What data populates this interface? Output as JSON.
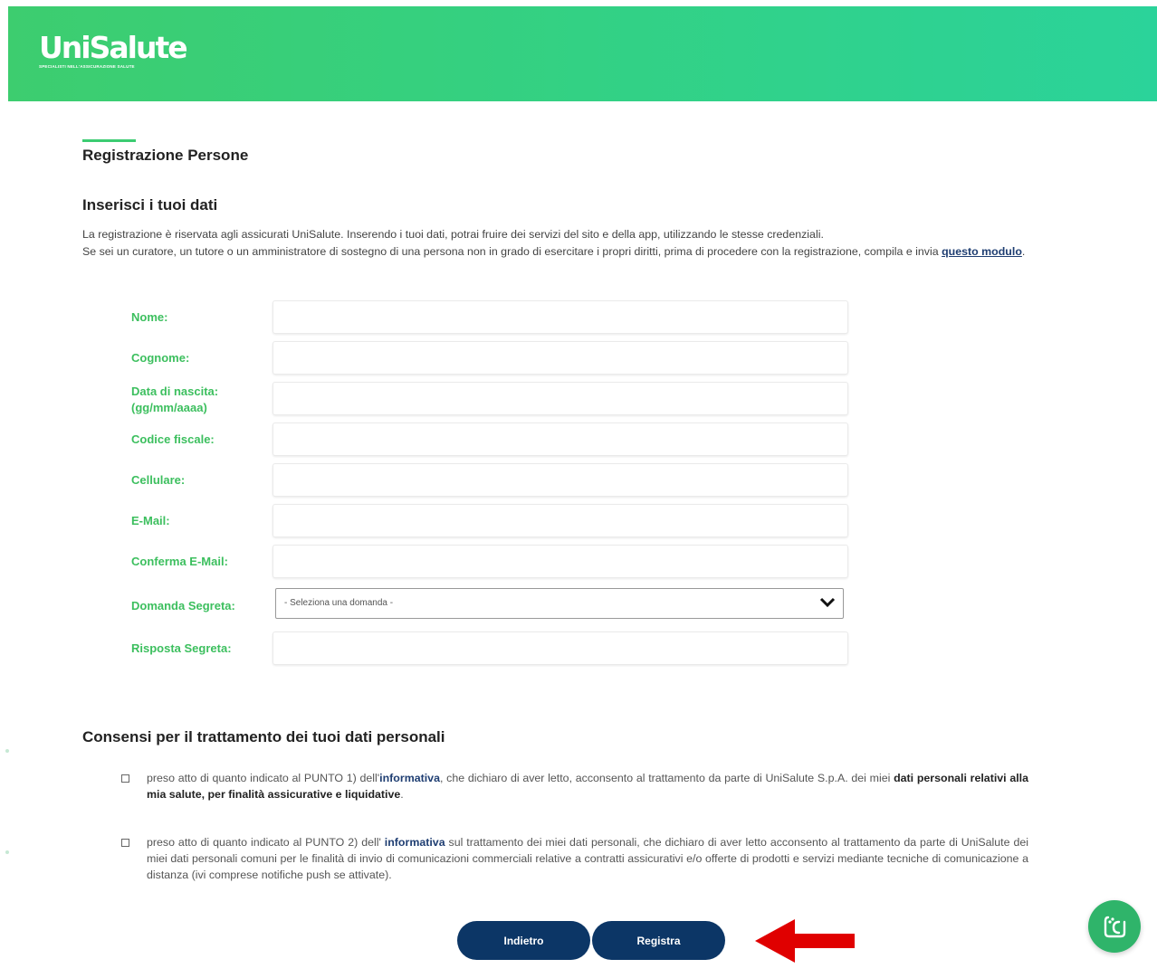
{
  "header": {
    "logo_text": "UniSalute",
    "logo_tagline": "SPECIALISTI NELL'ASSICURAZIONE SALUTE"
  },
  "page": {
    "title": "Registrazione Persone",
    "section_title": "Inserisci i tuoi dati",
    "intro_line1": "La registrazione è riservata agli assicurati UniSalute. Inserendo i tuoi dati, potrai fruire dei servizi del sito e della app, utilizzando le stesse credenziali.",
    "intro_line2": "Se sei un curatore, un tutore o un amministratore di sostegno di una persona non in grado di esercitare i propri diritti, prima di procedere con la registrazione, compila e invia",
    "intro_link": "questo modulo",
    "intro_end": "."
  },
  "form": {
    "nome_label": "Nome:",
    "cognome_label": "Cognome:",
    "nascita_label": "Data di nascita:",
    "nascita_format": "(gg/mm/aaaa)",
    "codice_label": "Codice fiscale:",
    "cellulare_label": "Cellulare:",
    "email_label": "E-Mail:",
    "conferma_email_label": "Conferma E-Mail:",
    "domanda_label": "Domanda Segreta:",
    "domanda_value": "- Seleziona una domanda -",
    "risposta_label": "Risposta Segreta:"
  },
  "consent": {
    "title": "Consensi per il trattamento dei tuoi dati personali",
    "item1_a": "preso atto di quanto indicato al PUNTO 1) dell'",
    "item1_link": "informativa",
    "item1_b": ", che dichiaro di aver letto, acconsento al trattamento da parte di UniSalute S.p.A. dei miei ",
    "item1_bold": "dati personali relativi alla mia salute, per finalità assicurative e liquidative",
    "item1_c": ".",
    "item2_a": "preso atto di quanto indicato al PUNTO 2) dell' ",
    "item2_link": "informativa",
    "item2_b": " sul trattamento dei miei dati personali, che dichiaro di aver letto acconsento al trattamento da parte di UniSalute dei miei dati personali comuni per le finalità di invio di comunicazioni commerciali relative a contratti assicurativi e/o offerte di prodotti e servizi mediante tecniche di comunicazione a distanza (ivi comprese notifiche push se attivate)."
  },
  "buttons": {
    "back": "Indietro",
    "register": "Registra"
  },
  "colors": {
    "brand_green": "#3ccc72",
    "button_navy": "#0c3666",
    "arrow_red": "#e00000"
  },
  "icons": {
    "chat": "chat-bot-icon",
    "select": "chevron-down-icon",
    "annotation": "arrow-left-icon"
  }
}
